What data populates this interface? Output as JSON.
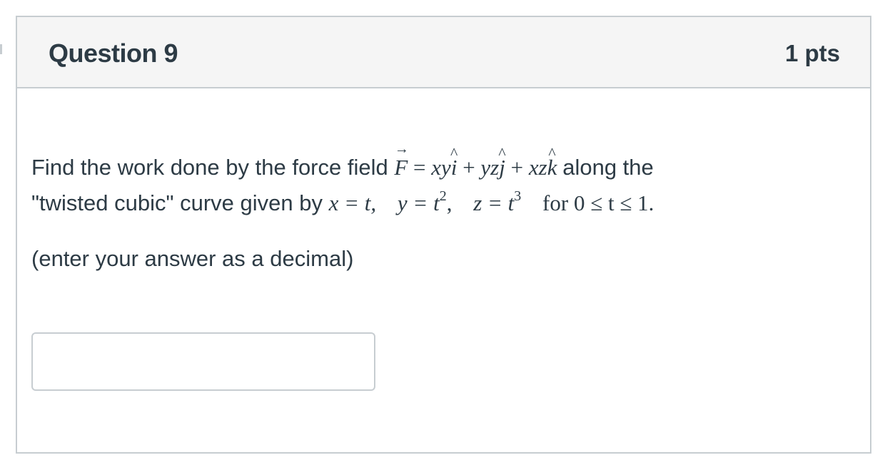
{
  "question": {
    "title": "Question 9",
    "points": "1 pts",
    "prompt_part1": "Find the work done by the force field",
    "prompt_part2": "along the",
    "prompt_part3": "\"twisted cubic\" curve given by",
    "field_equation": {
      "vector": "F",
      "eq": "=",
      "term1": "xy",
      "unit_i": "i",
      "plus1": "+",
      "term2": "yz",
      "unit_j": "j",
      "plus2": "+",
      "term3": "xz",
      "unit_k": "k"
    },
    "curve": {
      "x_eq": "x = t,",
      "y_eq": "y = t",
      "y_exp": "2",
      "y_comma": ",",
      "z_eq": "z = t",
      "z_exp": "3",
      "range_word": "for",
      "range": "0 ≤ t ≤ 1."
    },
    "hint": "(enter your answer as a decimal)",
    "answer_value": ""
  }
}
